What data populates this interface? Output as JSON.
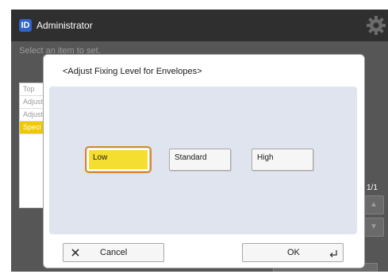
{
  "header": {
    "badge": "ID",
    "user": "Administrator",
    "settings_icon": "gear-icon"
  },
  "background": {
    "instruction": "Select an item to set.",
    "list_items": [
      "Top",
      "Adjust",
      "Adjust",
      "Speci"
    ],
    "page_indicator": "1/1"
  },
  "dialog": {
    "title": "<Adjust Fixing Level for Envelopes>",
    "options": [
      {
        "label": "Low",
        "selected": true
      },
      {
        "label": "Standard",
        "selected": false
      },
      {
        "label": "High",
        "selected": false
      }
    ],
    "cancel_label": "Cancel",
    "ok_label": "OK",
    "cancel_icon": "close-icon",
    "ok_icon": "enter-icon"
  },
  "colors": {
    "selected_fill": "#f4de30",
    "selected_ring": "#d58a2b",
    "list_selected": "#f0c800",
    "header_bg": "#2f2f2f",
    "badge": "#2f63c9"
  }
}
